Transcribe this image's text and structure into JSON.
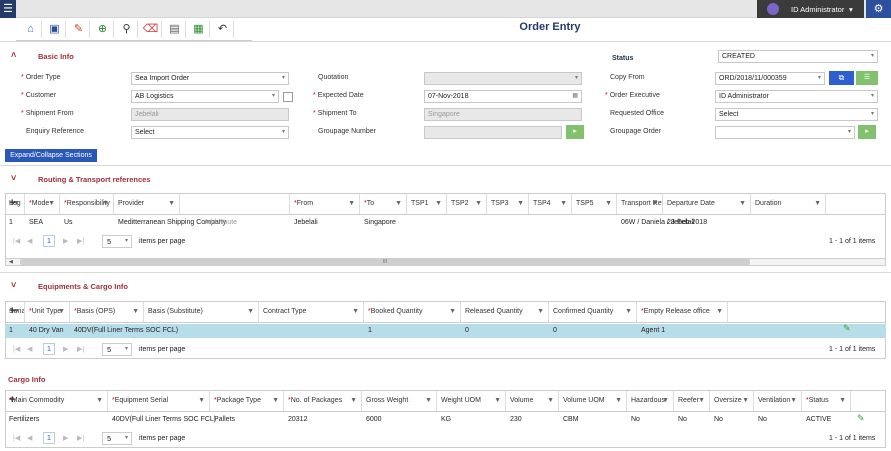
{
  "header": {
    "user": "ID Administrator",
    "title": "Order Entry"
  },
  "basic": {
    "section_label": "Basic Info",
    "status_label": "Status",
    "status_value": "CREATED",
    "order_type_label": "Order Type",
    "order_type_value": "Sea Import Order",
    "customer_label": "Customer",
    "customer_value": "AB Logistics",
    "shipment_from_label": "Shipment From",
    "shipment_from_value": "Jebelali",
    "enquiry_label": "Enquiry Reference",
    "enquiry_value": "Select",
    "quotation_label": "Quotation",
    "expected_date_label": "Expected Date",
    "expected_date_value": "07-Nov-2018",
    "shipment_to_label": "Shipment To",
    "shipment_to_value": "Singapore",
    "groupage_number_label": "Groupage Number",
    "copy_from_label": "Copy From",
    "copy_from_value": "ORD/2018/11/000359",
    "order_exec_label": "Order Executive",
    "order_exec_value": "ID Administrator",
    "req_office_label": "Requested Office",
    "req_office_value": "Select",
    "groupage_order_label": "Groupage Order"
  },
  "expand_label": "Expand/Collapse Sections",
  "routing": {
    "section_label": "Routing & Transport references",
    "columns": [
      "Leg",
      "Mode",
      "Responsibility",
      "Provider",
      "",
      "From",
      "To",
      "TSP1",
      "TSP2",
      "TSP3",
      "TSP4",
      "TSP5",
      "Transport Reference",
      "Departure Date",
      "Duration"
    ],
    "row": [
      "1",
      "SEA",
      "Us",
      "Meditterranean Shipping Company",
      "Add Route",
      "Jebelali",
      "Singapore",
      "",
      "",
      "",
      "",
      "",
      "06W / Daniela / Jebelali",
      "28-Feb-2018",
      ""
    ],
    "page": "1",
    "page_size": "5",
    "per_page": "items per page",
    "count": "1 - 1 of 1 items",
    "scroll_mid": "III"
  },
  "equipment": {
    "section_label": "Equipments & Cargo Info",
    "columns": [
      "Serial",
      "Unit Type",
      "Basis (OPS)",
      "Basis (Substitute)",
      "Contract Type",
      "Booked Quantity",
      "Released Quantity",
      "Confirmed Quantity",
      "Empty Release office"
    ],
    "row": [
      "1",
      "40 Dry Van",
      "40DV(Full Liner Terms SOC FCL)",
      "",
      "",
      "1",
      "0",
      "0",
      "Agent 1"
    ],
    "page": "1",
    "page_size": "5",
    "per_page": "items per page",
    "count": "1 - 1 of 1 items"
  },
  "cargo": {
    "section_label": "Cargo Info",
    "columns": [
      "Main Commodity",
      "Equipment Serial",
      "Package Type",
      "No. of Packages",
      "Gross Weight",
      "Weight UOM",
      "Volume",
      "Volume UOM",
      "Hazardous",
      "Reefer",
      "Oversize",
      "Ventilation",
      "Status"
    ],
    "row": [
      "Fertilizers",
      "40DV(Full Liner Terms SOC FCL)",
      "Pallets",
      "20312",
      "6000",
      "KG",
      "230",
      "CBM",
      "No",
      "No",
      "No",
      "No",
      "ACTIVE"
    ],
    "page": "1",
    "page_size": "5",
    "per_page": "items per page",
    "count": "1 - 1 of 1 items"
  },
  "colors": {
    "accent": "#233a6b",
    "section": "#a0303a",
    "selected_row": "#b7dde8"
  }
}
